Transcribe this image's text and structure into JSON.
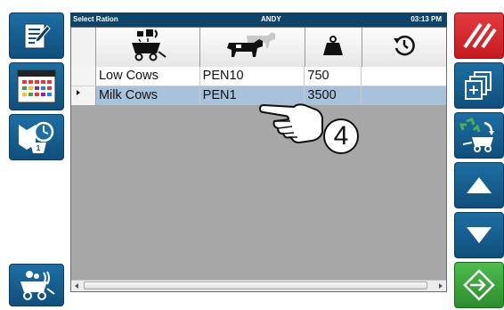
{
  "titlebar": {
    "title": "Select Ration",
    "user": "ANDY",
    "time": "03:13 PM"
  },
  "columns": [
    {
      "icon": "feed-mixer-icon"
    },
    {
      "icon": "cows-icon"
    },
    {
      "icon": "weight-icon"
    },
    {
      "icon": "history-clock-icon"
    }
  ],
  "rows": [
    {
      "name": "Low Cows",
      "pen": "PEN10",
      "amount": "750",
      "extra": "",
      "selected": false
    },
    {
      "name": "Milk Cows",
      "pen": "PEN1",
      "amount": "3500",
      "extra": "",
      "selected": true
    }
  ],
  "callout": {
    "number": "4",
    "icon": "pointing-hand-icon"
  },
  "left_buttons": [
    {
      "icon": "edit-note-icon"
    },
    {
      "icon": "calendar-icon"
    },
    {
      "icon": "bunk-schedule-icon"
    },
    {
      "icon": "ingredient-loader-icon"
    }
  ],
  "right_buttons": [
    {
      "icon": "cancel-slash-icon",
      "color": "#d8232a"
    },
    {
      "icon": "add-copy-icon",
      "color": "#1d6ea3"
    },
    {
      "icon": "recycle-mixer-icon",
      "color": "#1d6ea3"
    },
    {
      "icon": "arrow-up-icon",
      "color": "#1d6ea3"
    },
    {
      "icon": "arrow-down-icon",
      "color": "#1d6ea3"
    },
    {
      "icon": "enter-arrow-icon",
      "color": "#3aa63a"
    }
  ],
  "colors": {
    "titlebar_bg": "#0d4468",
    "grid_bg": "#a7a7a7",
    "selected_row": "#a9c2dc",
    "button_blue": "#1d6ea3",
    "button_red": "#d8232a",
    "button_green": "#3aa63a"
  }
}
